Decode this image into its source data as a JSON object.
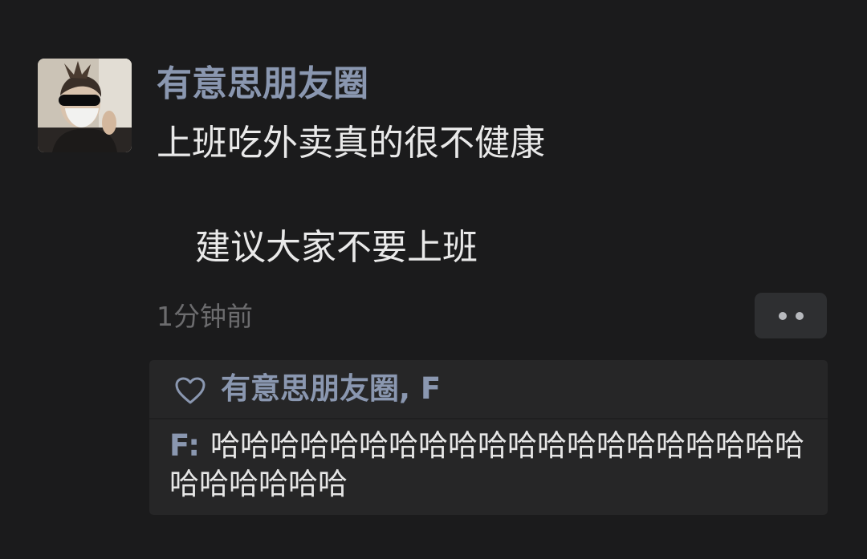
{
  "post": {
    "author": "有意思朋友圈",
    "text_line1": "上班吃外卖真的很不健康",
    "text_line2": "建议大家不要上班",
    "timestamp": "1分钟前",
    "more_icon": "more-dots-icon"
  },
  "likes": {
    "icon": "heart-outline-icon",
    "names": "有意思朋友圈, F"
  },
  "comments": [
    {
      "author": "F",
      "separator": ": ",
      "text": "哈哈哈哈哈哈哈哈哈哈哈哈哈哈哈哈哈哈哈哈哈哈哈哈哈哈"
    }
  ],
  "colors": {
    "background": "#1b1b1c",
    "name_blue": "#8a97b0",
    "text_primary": "#e9e9e9",
    "text_secondary": "#6c6c6e",
    "panel": "#262627"
  }
}
